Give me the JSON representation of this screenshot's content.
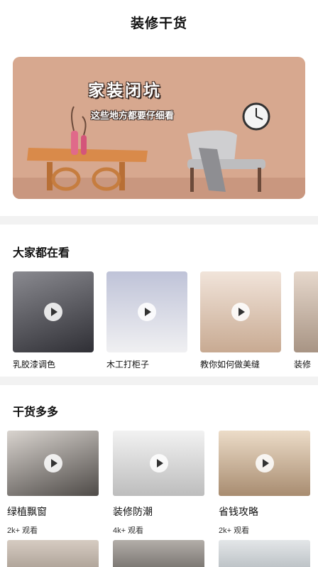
{
  "header": {
    "title": "装修干货"
  },
  "banner": {
    "title": "家装闭坑",
    "subtitle": "这些地方都要仔细看"
  },
  "popular": {
    "title": "大家都在看",
    "items": [
      {
        "label": "乳胶漆调色",
        "thumb_color": "#4a4a52"
      },
      {
        "label": "木工打柜子",
        "thumb_color": "#d9d9df"
      },
      {
        "label": "教你如何做美缝",
        "thumb_color": "#e2d4c7"
      },
      {
        "label": "装修",
        "thumb_color": "#c9b8a8"
      }
    ]
  },
  "tips": {
    "title": "干货多多",
    "items": [
      {
        "title": "绿植飘窗",
        "views": "2k+ 观看",
        "thumb_color": "#5d5a57"
      },
      {
        "title": "装修防潮",
        "views": "4k+ 观看",
        "thumb_color": "#e6e6e6"
      },
      {
        "title": "省钱攻略",
        "views": "2k+ 观看",
        "thumb_color": "#d8c2a8"
      },
      {
        "title": "",
        "views": "",
        "thumb_color": "#b9aea3"
      },
      {
        "title": "",
        "views": "",
        "thumb_color": "#8f8a86"
      },
      {
        "title": "",
        "views": "",
        "thumb_color": "#cfd3d6"
      }
    ]
  }
}
